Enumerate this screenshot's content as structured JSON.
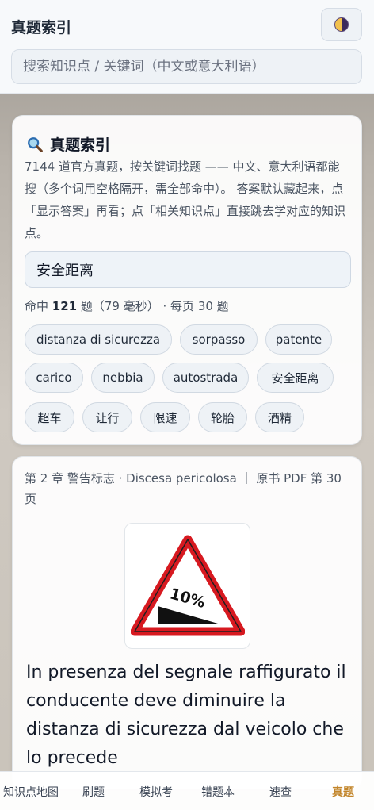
{
  "header": {
    "title": "真题索引",
    "theme_toggle_icon": "half-moon-icon"
  },
  "search": {
    "placeholder": "搜索知识点 / 关键词（中文或意大利语）",
    "value": ""
  },
  "index_card": {
    "icon": "magnifier-icon",
    "title": "真题索引",
    "intro": "7144 道官方真题，按关键词找题 —— 中文、意大利语都能搜（多个词用空格隔开，需全部命中）。 答案默认藏起来，点「显示答案」再看；点「相关知识点」直接跳去学对应的知识点。",
    "query": "安全距离",
    "hits_prefix": "命中",
    "hits_count": "121",
    "hits_suffix": "题（79 毫秒） · 每页 30 题",
    "chips": [
      "distanza di sicurezza",
      "sorpasso",
      "patente",
      "carico",
      "nebbia",
      "autostrada",
      "安全距离",
      "超车",
      "让行",
      "限速",
      "轮胎",
      "酒精"
    ]
  },
  "question_card": {
    "meta": "第 2 章 警告标志 · Discesa pericolosa ｜ 原书 PDF 第 30 页",
    "sign_icon": "steep-descent-sign",
    "sign_text": "10%",
    "question": "In presenza del segnale raffigurato il conducente deve diminuire la distanza di sicurezza dal veicolo che lo precede"
  },
  "nav": {
    "items": [
      "知识点地图",
      "刷题",
      "模拟考",
      "错题本",
      "速查",
      "真题"
    ],
    "active": "真题"
  },
  "colors": {
    "accent": "#c2852a",
    "sign_red": "#d71920"
  }
}
